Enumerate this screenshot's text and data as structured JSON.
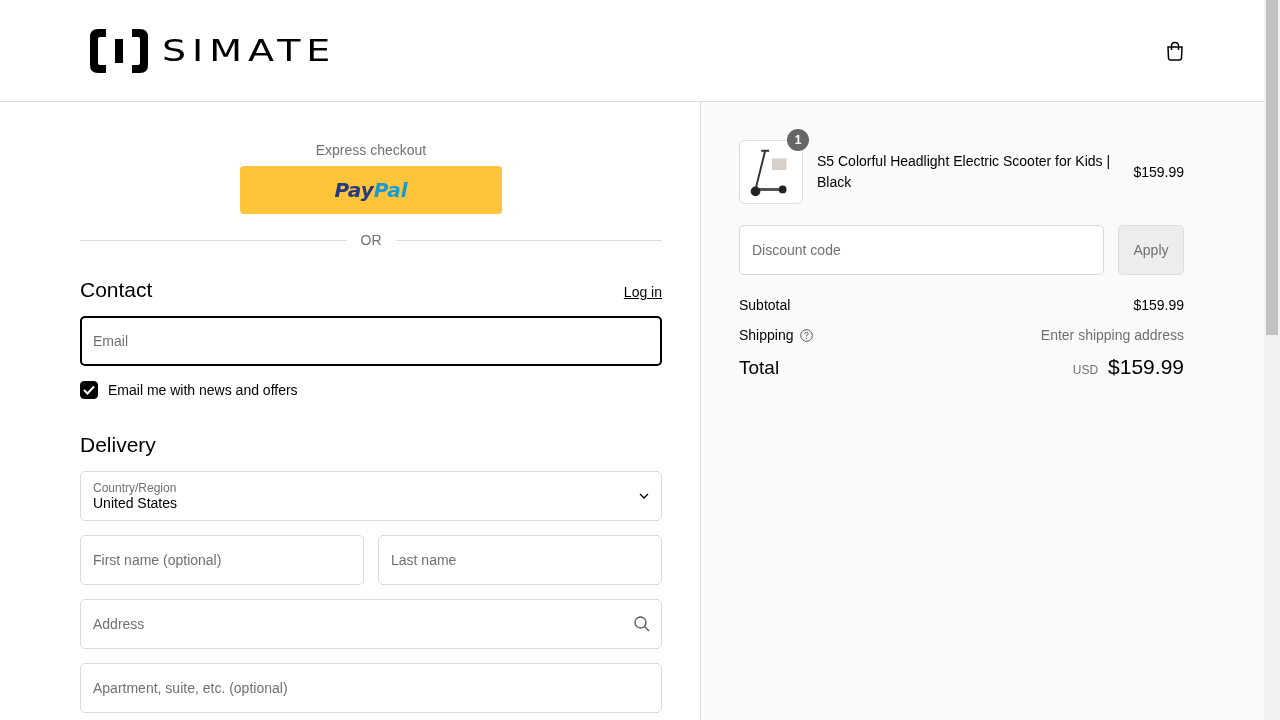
{
  "header": {
    "brand": "SIMATE"
  },
  "express": {
    "title": "Express checkout",
    "paypal": {
      "part_1": "Pay",
      "part_2": "Pal"
    },
    "divider": "OR"
  },
  "contact": {
    "heading": "Contact",
    "login_link": "Log in",
    "email": {
      "placeholder": "Email",
      "focused": true
    },
    "newsletter": {
      "label": "Email me with news and offers",
      "checked": true
    }
  },
  "delivery": {
    "heading": "Delivery",
    "fields": [
      {
        "kind": "select",
        "label": "Country/Region",
        "value": "United States"
      },
      {
        "kind": "pair",
        "items": [
          {
            "placeholder": "First name (optional)"
          },
          {
            "placeholder": "Last name"
          }
        ]
      },
      {
        "kind": "search",
        "placeholder": "Address"
      },
      {
        "kind": "text",
        "placeholder": "Apartment, suite, etc. (optional)"
      }
    ]
  },
  "summary": {
    "items": [
      {
        "quantity": "1",
        "name": "S5 Colorful Headlight Electric Scooter for Kids | Black",
        "price": "$159.99"
      }
    ],
    "discount": {
      "placeholder": "Discount code",
      "button": "Apply"
    },
    "subtotal": {
      "label": "Subtotal",
      "value": "$159.99"
    },
    "shipping": {
      "label": "Shipping",
      "value": "Enter shipping address"
    },
    "total": {
      "label": "Total",
      "currency": "USD",
      "value": "$159.99"
    }
  }
}
